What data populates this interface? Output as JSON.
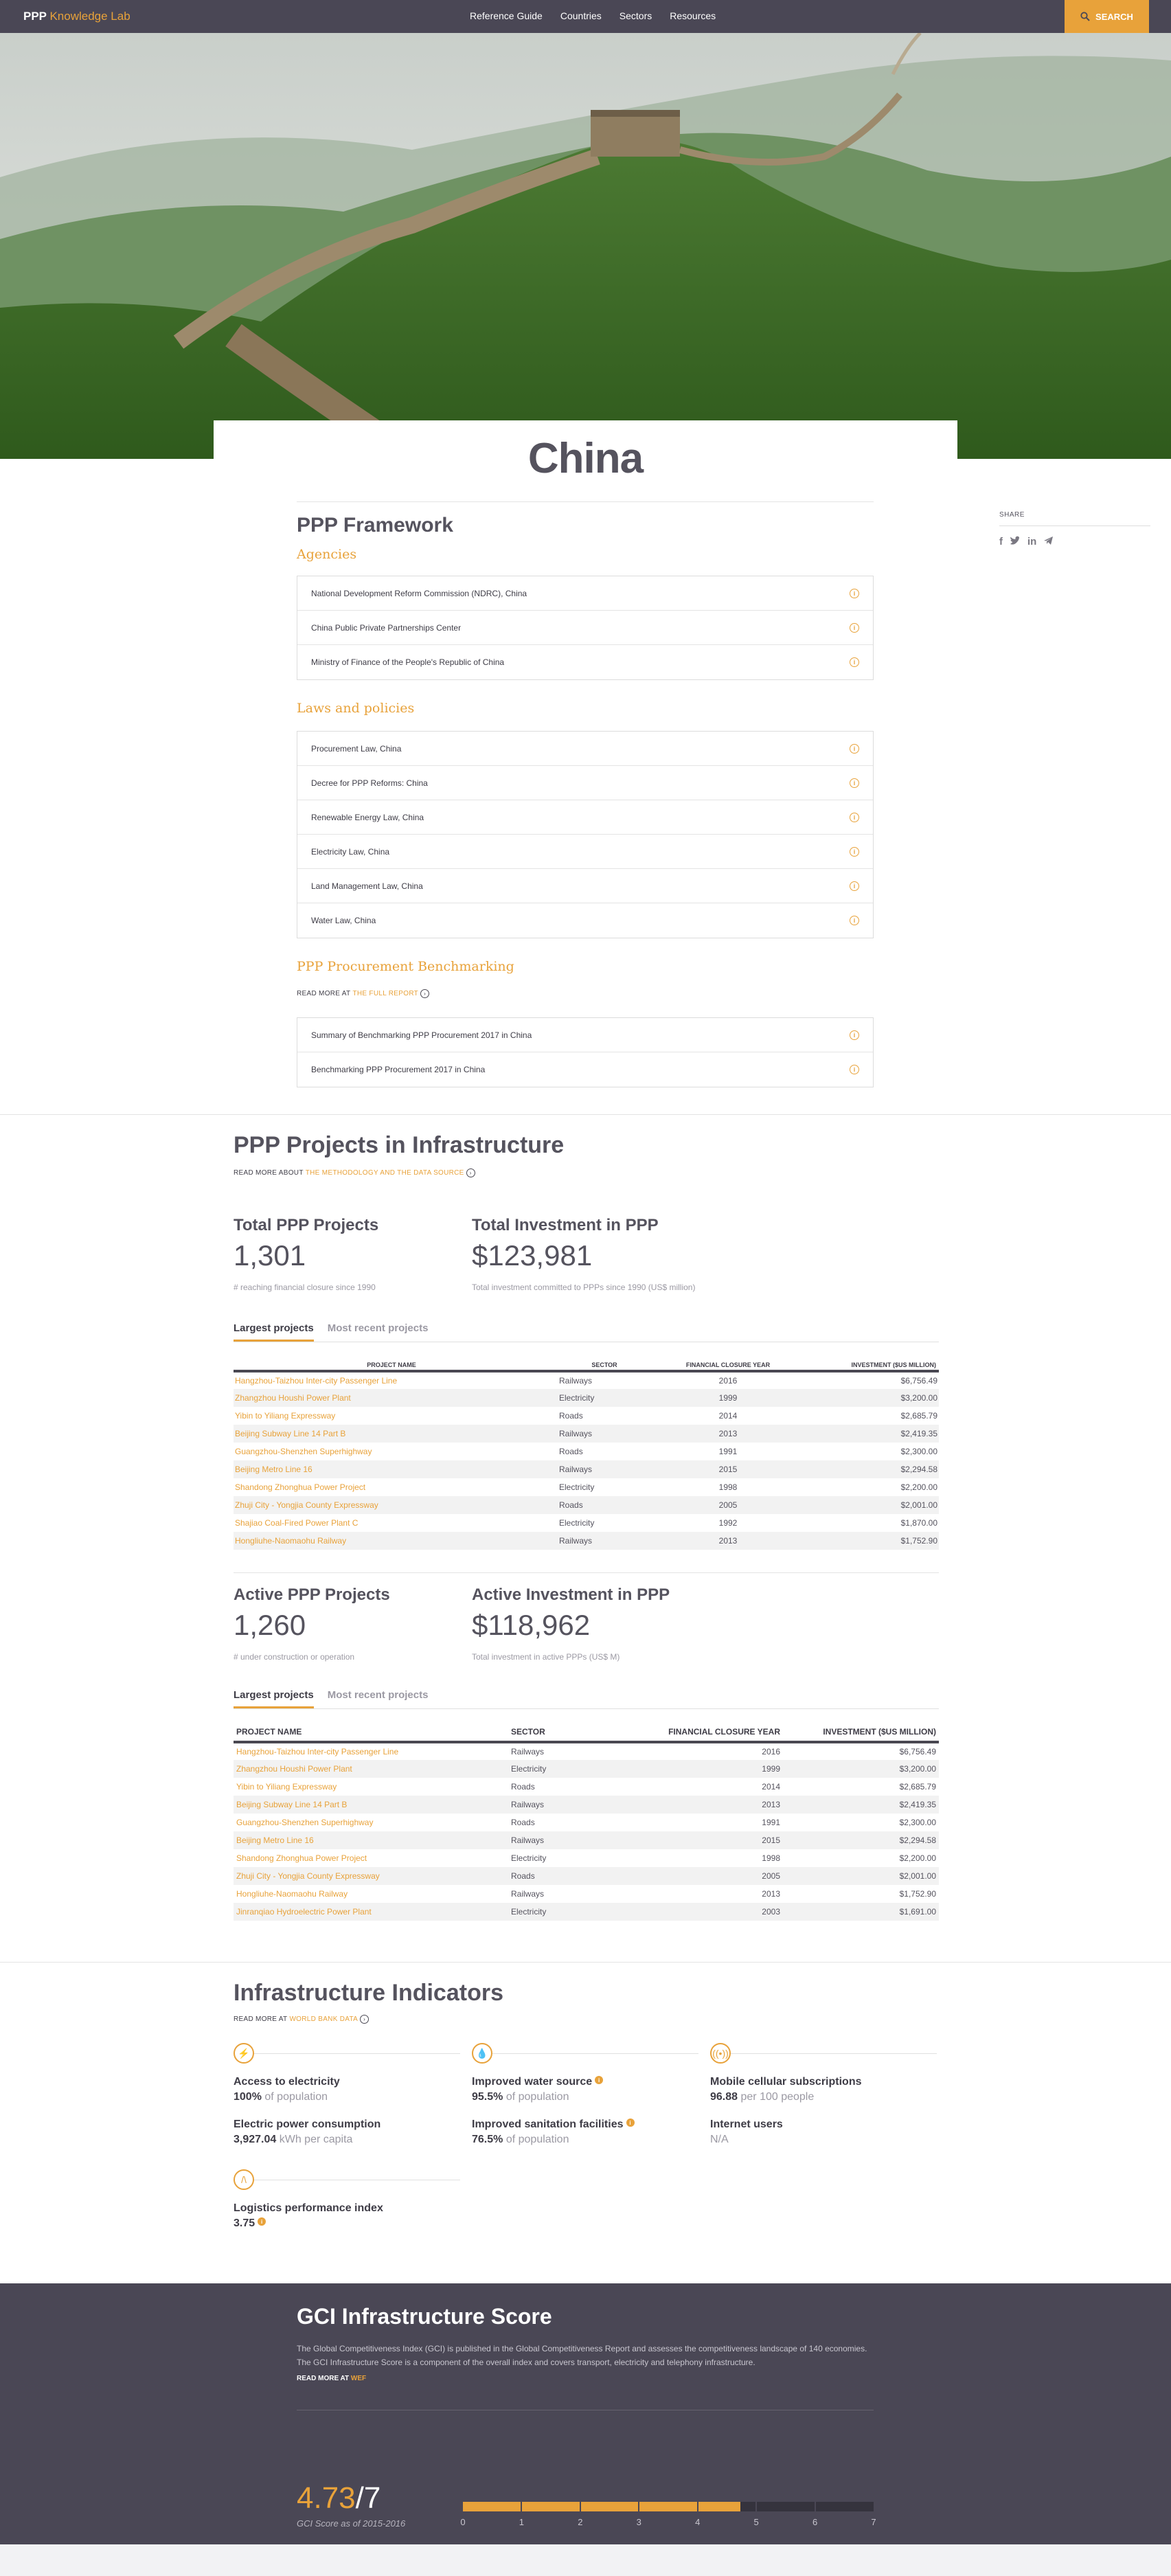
{
  "header": {
    "logo_ppp": "PPP",
    "logo_kl": "Knowledge Lab",
    "nav": [
      "Reference Guide",
      "Countries",
      "Sectors",
      "Resources"
    ],
    "search_label": "SEARCH"
  },
  "page": {
    "title": "China"
  },
  "share": {
    "label": "SHARE",
    "icons": [
      "facebook-icon",
      "twitter-icon",
      "linkedin-icon",
      "telegram-icon"
    ]
  },
  "framework": {
    "title": "PPP Framework",
    "agencies_title": "Agencies",
    "agencies": [
      "National Development Reform Commission (NDRC), China",
      "China Public Private Partnerships Center",
      "Ministry of Finance of the People's Republic of China"
    ],
    "laws_title": "Laws and policies",
    "laws": [
      "Procurement Law, China",
      "Decree for PPP Reforms: China",
      "Renewable Energy Law, China",
      "Electricity Law, China",
      "Land Management Law, China",
      "Water Law, China"
    ],
    "bench_title": "PPP Procurement Benchmarking",
    "bench_readmore": "READ MORE AT",
    "bench_link": "THE FULL REPORT",
    "bench": [
      "Summary of Benchmarking PPP Procurement 2017 in China",
      "Benchmarking PPP Procurement 2017 in China"
    ]
  },
  "projects": {
    "title": "PPP Projects in Infrastructure",
    "readmore": "READ MORE ABOUT",
    "readmore_link": "THE METHODOLOGY AND THE DATA SOURCE",
    "total_label": "Total PPP Projects",
    "total_value": "1,301",
    "total_sub": "# reaching financial closure since 1990",
    "invest_label": "Total Investment in PPP",
    "invest_value": "$123,981",
    "invest_sub": "Total investment committed to PPPs since 1990 (US$ million)",
    "tab_largest": "Largest projects",
    "tab_recent": "Most recent projects",
    "cols": [
      "PROJECT NAME",
      "SECTOR",
      "FINANCIAL CLOSURE YEAR",
      "INVESTMENT ($US MILLION)"
    ],
    "rows": [
      [
        "Hangzhou-Taizhou Inter-city Passenger Line",
        "Railways",
        "2016",
        "$6,756.49"
      ],
      [
        "Zhangzhou Houshi Power Plant",
        "Electricity",
        "1999",
        "$3,200.00"
      ],
      [
        "Yibin to Yiliang Expressway",
        "Roads",
        "2014",
        "$2,685.79"
      ],
      [
        "Beijing Subway Line 14 Part B",
        "Railways",
        "2013",
        "$2,419.35"
      ],
      [
        "Guangzhou-Shenzhen Superhighway",
        "Roads",
        "1991",
        "$2,300.00"
      ],
      [
        "Beijing Metro Line 16",
        "Railways",
        "2015",
        "$2,294.58"
      ],
      [
        "Shandong Zhonghua Power Project",
        "Electricity",
        "1998",
        "$2,200.00"
      ],
      [
        "Zhuji City - Yongjia County Expressway",
        "Roads",
        "2005",
        "$2,001.00"
      ],
      [
        "Shajiao Coal-Fired Power Plant C",
        "Electricity",
        "1992",
        "$1,870.00"
      ],
      [
        "Hongliuhe-Naomaohu Railway",
        "Railways",
        "2013",
        "$1,752.90"
      ]
    ],
    "active_label": "Active PPP Projects",
    "active_value": "1,260",
    "active_sub": "# under construction or operation",
    "active_invest_label": "Active Investment in PPP",
    "active_invest_value": "$118,962",
    "active_invest_sub": "Total investment in active PPPs (US$ M)",
    "cols2": [
      "PROJECT NAME",
      "SECTOR",
      "FINANCIAL CLOSURE YEAR",
      "INVESTMENT ($US MILLION)"
    ],
    "rows2": [
      [
        "Hangzhou-Taizhou Inter-city Passenger Line",
        "Railways",
        "2016",
        "$6,756.49"
      ],
      [
        "Zhangzhou Houshi Power Plant",
        "Electricity",
        "1999",
        "$3,200.00"
      ],
      [
        "Yibin to Yiliang Expressway",
        "Roads",
        "2014",
        "$2,685.79"
      ],
      [
        "Beijing Subway Line 14 Part B",
        "Railways",
        "2013",
        "$2,419.35"
      ],
      [
        "Guangzhou-Shenzhen Superhighway",
        "Roads",
        "1991",
        "$2,300.00"
      ],
      [
        "Beijing Metro Line 16",
        "Railways",
        "2015",
        "$2,294.58"
      ],
      [
        "Shandong Zhonghua Power Project",
        "Electricity",
        "1998",
        "$2,200.00"
      ],
      [
        "Zhuji City - Yongjia County Expressway",
        "Roads",
        "2005",
        "$2,001.00"
      ],
      [
        "Hongliuhe-Naomaohu Railway",
        "Railways",
        "2013",
        "$1,752.90"
      ],
      [
        "Jinranqiao Hydroelectric Power Plant",
        "Electricity",
        "2003",
        "$1,691.00"
      ]
    ]
  },
  "indicators": {
    "title": "Infrastructure Indicators",
    "readmore": "READ MORE AT",
    "readmore_link": "WORLD BANK DATA",
    "electricity_label": "Access to electricity",
    "electricity_value": "100%",
    "electricity_unit": "of population",
    "power_label": "Electric power consumption",
    "power_value": "3,927.04",
    "power_unit": "kWh per capita",
    "water_label": "Improved water source",
    "water_value": "95.5%",
    "water_unit": "of population",
    "sanitation_label": "Improved sanitation facilities",
    "sanitation_value": "76.5%",
    "sanitation_unit": "of population",
    "mobile_label": "Mobile cellular subscriptions",
    "mobile_value": "96.88",
    "mobile_unit": "per 100 people",
    "internet_label": "Internet users",
    "internet_value": "N/A",
    "logistics_label": "Logistics performance index",
    "logistics_value": "3.75"
  },
  "gci": {
    "title": "GCI Infrastructure Score",
    "description": "The Global Competitiveness Index (GCI) is published in the Global Competitiveness Report and assesses the competitiveness landscape of 140 economies. The GCI Infrastructure Score is a component of the overall index and covers transport, electricity and telephony infrastructure.",
    "readmore": "READ MORE AT",
    "readmore_link": "WEF",
    "score": "4.73",
    "score_total": "/7",
    "score_value": 4.73,
    "scale_max": 7,
    "subtitle": "GCI Score as of 2015-2016",
    "ticks": [
      "0",
      "1",
      "2",
      "3",
      "4",
      "5",
      "6",
      "7"
    ]
  }
}
